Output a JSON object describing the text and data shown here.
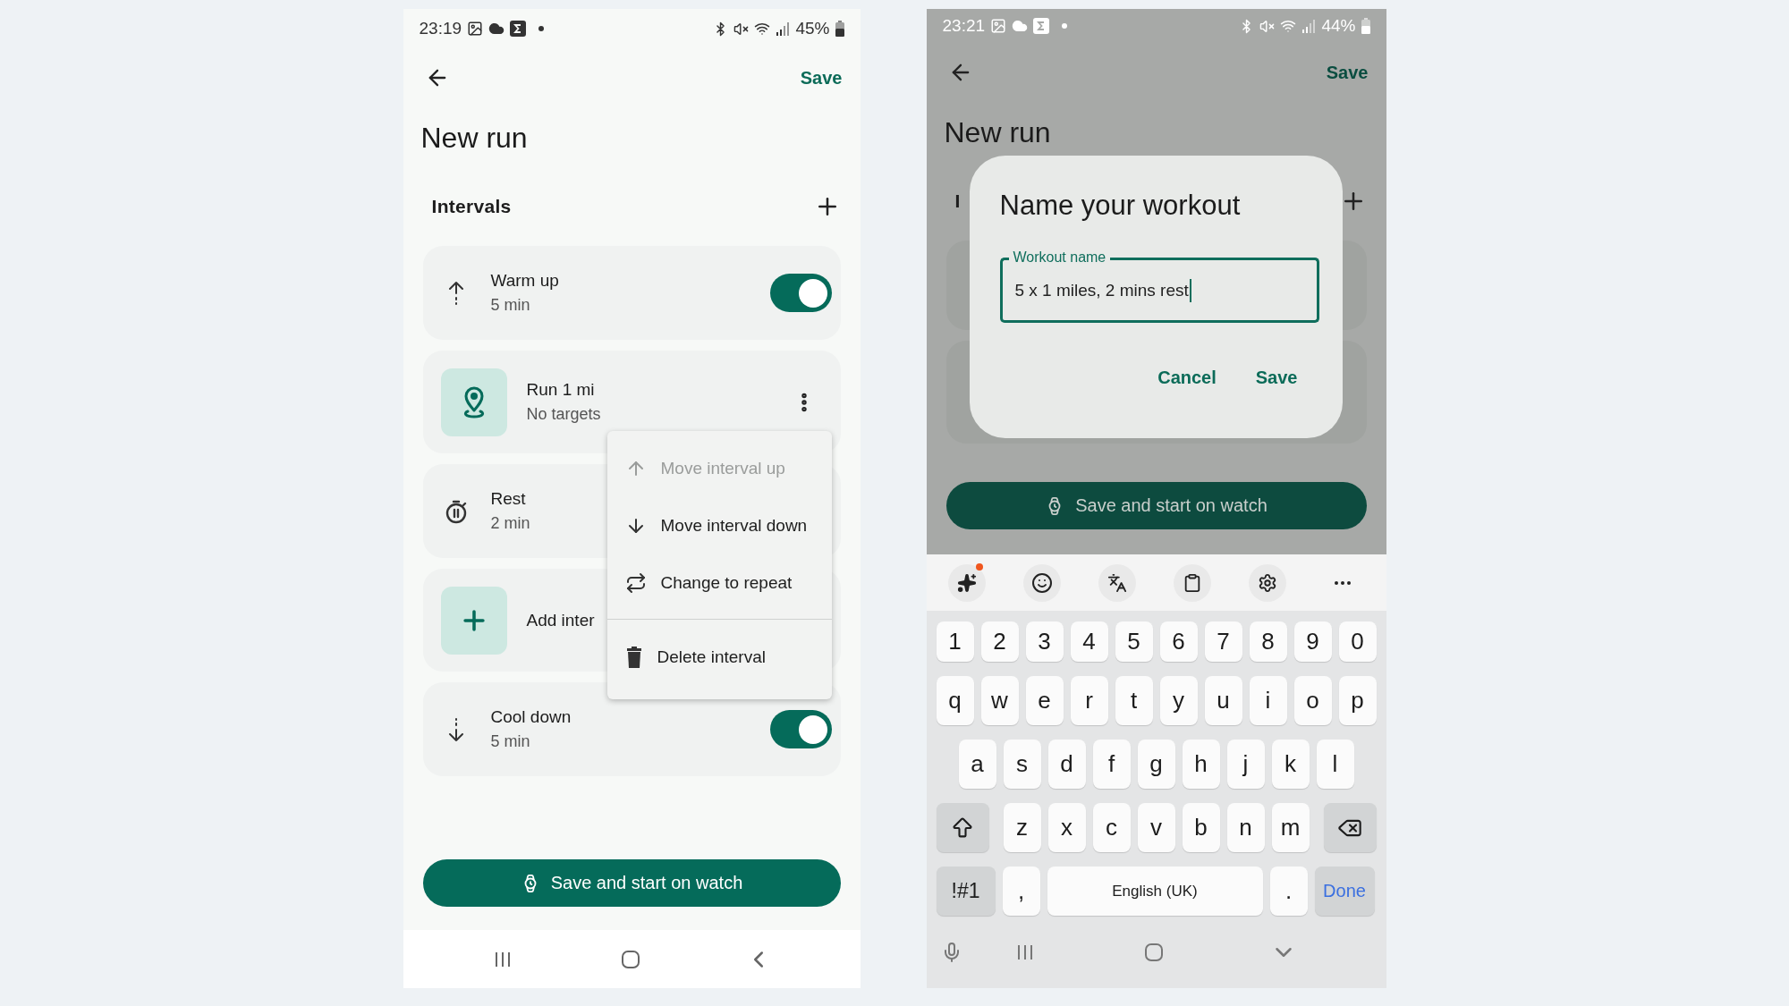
{
  "left_screen": {
    "status_bar": {
      "time": "23:19",
      "battery": "45%"
    },
    "save_action": "Save",
    "title": "New run",
    "section_title": "Intervals",
    "intervals": [
      {
        "kind": "toggle",
        "title": "Warm up",
        "subtitle": "5 min",
        "on": true
      },
      {
        "kind": "tile",
        "title": "Run 1 mi",
        "subtitle": "No targets"
      },
      {
        "kind": "plain",
        "title": "Rest",
        "subtitle": "2 min"
      },
      {
        "kind": "add",
        "title": "Add inter"
      },
      {
        "kind": "toggle",
        "title": "Cool down",
        "subtitle": "5 min",
        "on": true
      }
    ],
    "context_menu": [
      {
        "label": "Move interval up",
        "disabled": true
      },
      {
        "label": "Move interval down",
        "disabled": false
      },
      {
        "label": "Change to repeat",
        "disabled": false
      },
      {
        "label": "Delete interval",
        "disabled": false
      }
    ],
    "primary_button": "Save and start on watch"
  },
  "right_screen": {
    "status_bar": {
      "time": "23:21",
      "battery": "44%"
    },
    "save_action": "Save",
    "title": "New run",
    "section_title": "I",
    "primary_button": "Save and start on watch",
    "dialog": {
      "title": "Name your workout",
      "field": {
        "label": "Workout name",
        "value": "5 x 1 miles, 2 mins rest"
      },
      "buttons": [
        "Cancel",
        "Save"
      ]
    },
    "keyboard": {
      "ai_badge": true,
      "rows": [
        [
          "1",
          "2",
          "3",
          "4",
          "5",
          "6",
          "7",
          "8",
          "9",
          "0"
        ],
        [
          "q",
          "w",
          "e",
          "r",
          "t",
          "y",
          "u",
          "i",
          "o",
          "p"
        ],
        [
          "a",
          "s",
          "d",
          "f",
          "g",
          "h",
          "j",
          "k",
          "l"
        ],
        [
          "z",
          "x",
          "c",
          "v",
          "b",
          "n",
          "m"
        ]
      ],
      "bottom_row": {
        "symbols": "!#1",
        "comma": ",",
        "space": "English (UK)",
        "period": ".",
        "action": "Done"
      }
    }
  }
}
